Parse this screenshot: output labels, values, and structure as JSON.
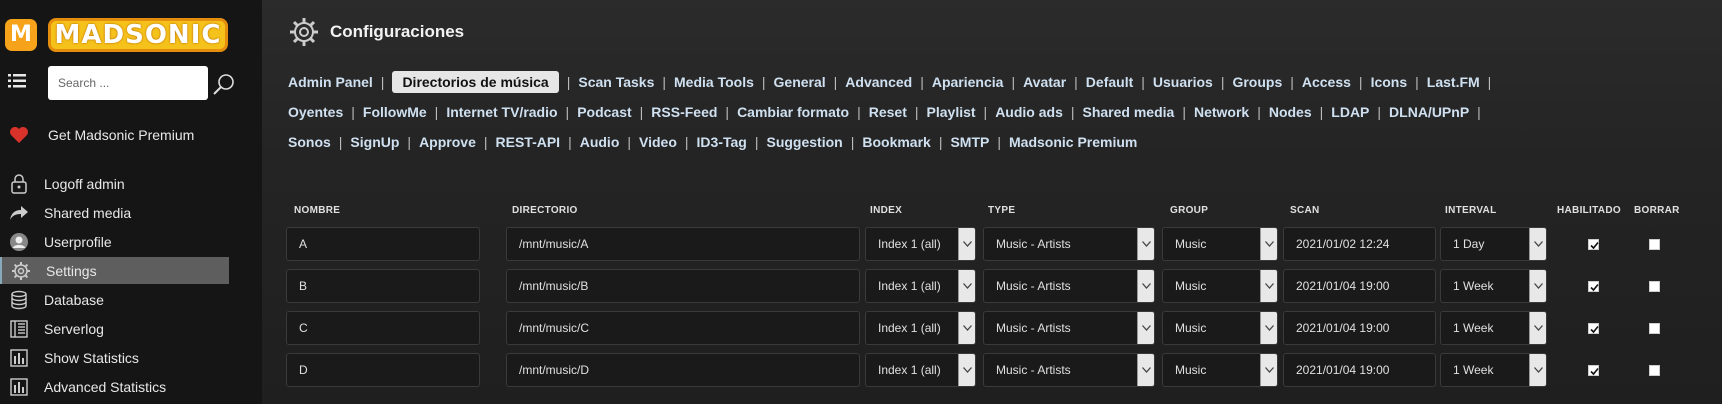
{
  "app": {
    "logo_letter": "M",
    "logo_text": "MADSONIC"
  },
  "search": {
    "placeholder": "Search ..."
  },
  "sidebar": {
    "premium_label": "Get Madsonic Premium",
    "items": [
      {
        "label": "Logoff admin",
        "icon": "lock-icon"
      },
      {
        "label": "Shared media",
        "icon": "share-icon"
      },
      {
        "label": "Userprofile",
        "icon": "user-icon"
      },
      {
        "label": "Settings",
        "icon": "gear-icon",
        "active": true
      },
      {
        "label": "Database",
        "icon": "database-icon"
      },
      {
        "label": "Serverlog",
        "icon": "log-icon"
      },
      {
        "label": "Show Statistics",
        "icon": "statistics-icon"
      },
      {
        "label": "Advanced Statistics",
        "icon": "statistics-icon"
      }
    ]
  },
  "page": {
    "title": "Configuraciones"
  },
  "tabs": {
    "row1": [
      "Admin Panel",
      "Directorios de música",
      "Scan Tasks",
      "Media Tools",
      "General",
      "Advanced",
      "Apariencia",
      "Avatar",
      "Default",
      "Usuarios",
      "Groups",
      "Access",
      "Icons",
      "Last.FM"
    ],
    "row2": [
      "Oyentes",
      "FollowMe",
      "Internet TV/radio",
      "Podcast",
      "RSS-Feed",
      "Cambiar formato",
      "Reset",
      "Playlist",
      "Audio ads",
      "Shared media",
      "Network",
      "Nodes",
      "LDAP",
      "DLNA/UPnP"
    ],
    "row3": [
      "Sonos",
      "SignUp",
      "Approve",
      "REST-API",
      "Audio",
      "Video",
      "ID3-Tag",
      "Suggestion",
      "Bookmark",
      "SMTP",
      "Madsonic Premium"
    ],
    "selected": "Directorios de música"
  },
  "table": {
    "headers": {
      "name": "NOMBRE",
      "dir": "DIRECTORIO",
      "index": "INDEX",
      "type": "TYPE",
      "group": "GROUP",
      "scan": "SCAN",
      "interval": "INTERVAL",
      "enabled": "HABILITADO",
      "delete": "BORRAR"
    },
    "rows": [
      {
        "name": "A",
        "dir": "/mnt/music/A",
        "index": "Index 1 (all)",
        "type": "Music - Artists",
        "group": "Music",
        "scan": "2021/01/02 12:24",
        "interval": "1 Day",
        "enabled": true,
        "delete": false
      },
      {
        "name": "B",
        "dir": "/mnt/music/B",
        "index": "Index 1 (all)",
        "type": "Music - Artists",
        "group": "Music",
        "scan": "2021/01/04 19:00",
        "interval": "1 Week",
        "enabled": true,
        "delete": false
      },
      {
        "name": "C",
        "dir": "/mnt/music/C",
        "index": "Index 1 (all)",
        "type": "Music - Artists",
        "group": "Music",
        "scan": "2021/01/04 19:00",
        "interval": "1 Week",
        "enabled": true,
        "delete": false
      },
      {
        "name": "D",
        "dir": "/mnt/music/D",
        "index": "Index 1 (all)",
        "type": "Music - Artists",
        "group": "Music",
        "scan": "2021/01/04 19:00",
        "interval": "1 Week",
        "enabled": true,
        "delete": false
      }
    ]
  }
}
